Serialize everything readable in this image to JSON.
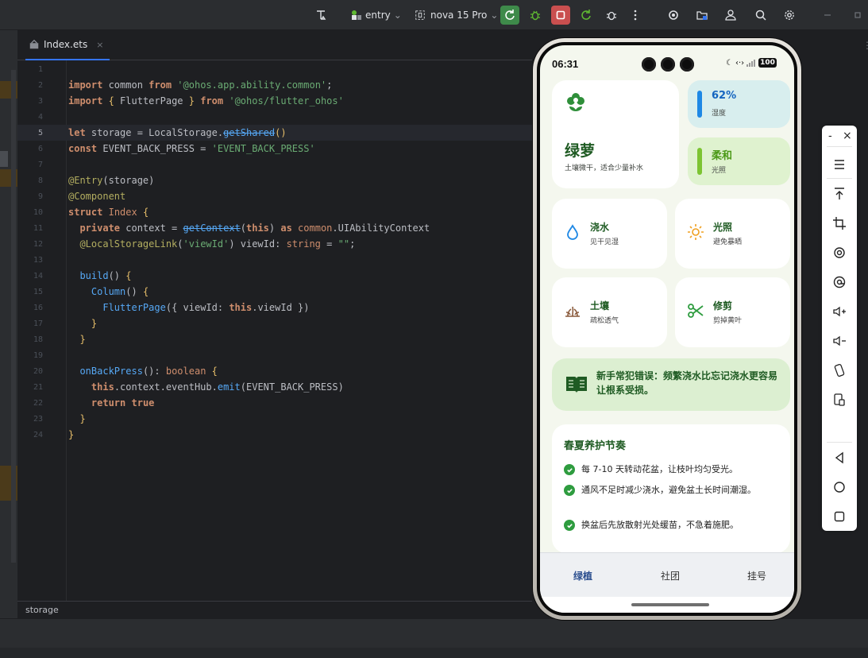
{
  "toolbar": {
    "module": "entry",
    "device": "nova 15 Pro"
  },
  "editor": {
    "tab_label": "Index.ets",
    "tab_close": "×",
    "breadcrumb": "storage",
    "line_numbers": [
      "1",
      "2",
      "3",
      "4",
      "5",
      "6",
      "7",
      "8",
      "9",
      "10",
      "11",
      "12",
      "13",
      "14",
      "15",
      "16",
      "17",
      "18",
      "19",
      "20",
      "21",
      "22",
      "23",
      "24"
    ]
  },
  "phone": {
    "status": {
      "time": "06:31",
      "battery": "100"
    },
    "plant": {
      "name": "绿萝",
      "desc": "土壤微干，适合少量补水"
    },
    "stats": [
      {
        "value": "62%",
        "label": "湿度",
        "color": "#1e88e5"
      },
      {
        "value": "柔和",
        "label": "光照",
        "color": "#7cc431"
      }
    ],
    "care": [
      {
        "title": "浇水",
        "subtitle": "见干见湿",
        "icon": "water-drop-icon"
      },
      {
        "title": "光照",
        "subtitle": "避免暴晒",
        "icon": "sun-icon"
      },
      {
        "title": "土壤",
        "subtitle": "疏松透气",
        "icon": "soil-icon"
      },
      {
        "title": "修剪",
        "subtitle": "剪掉黄叶",
        "icon": "scissors-icon"
      }
    ],
    "tip": "新手常犯错误：频繁浇水比忘记浇水更容易让根系受损。",
    "season": {
      "heading": "春夏养护节奏",
      "items": [
        "每 7-10 天转动花盆，让枝叶均匀受光。",
        "通风不足时减少浇水，避免盆土长时间潮湿。",
        "换盆后先放散射光处缓苗，不急着施肥。"
      ]
    },
    "nav": [
      "绿植",
      "社团",
      "挂号"
    ],
    "accent": "#1f5b23"
  },
  "emulator_toolbar": {
    "minimize": "-",
    "close": "×"
  }
}
